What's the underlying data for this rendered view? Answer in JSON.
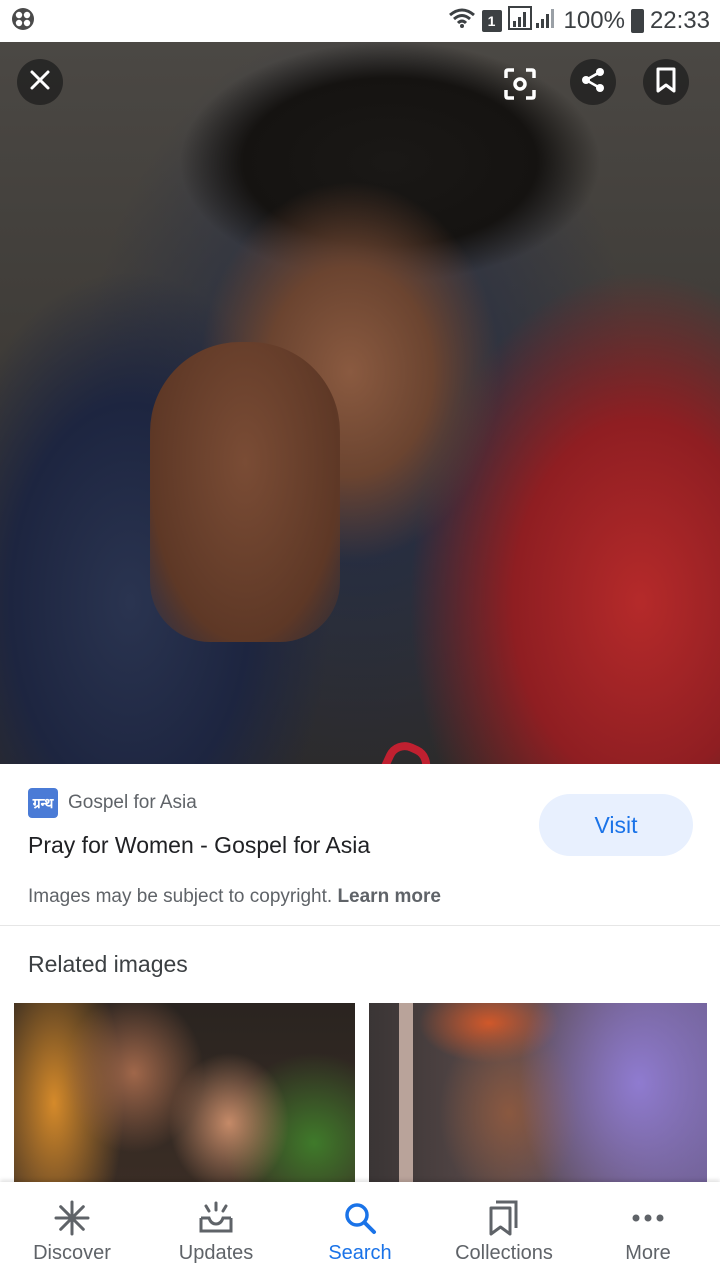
{
  "status_bar": {
    "sim_slot": "1",
    "battery": "100%",
    "time": "22:33"
  },
  "source": {
    "favicon_text": "ग्रन्थ",
    "name": "Gospel for Asia"
  },
  "result": {
    "title": "Pray for Women - Gospel for Asia",
    "visit_label": "Visit"
  },
  "copyright": {
    "text": "Images may be subject to copyright.",
    "learn_more": "Learn more"
  },
  "related": {
    "title": "Related images"
  },
  "nav": {
    "items": [
      {
        "label": "Discover",
        "icon": "asterisk-icon"
      },
      {
        "label": "Updates",
        "icon": "updates-tray-icon"
      },
      {
        "label": "Search",
        "icon": "search-icon"
      },
      {
        "label": "Collections",
        "icon": "collections-icon"
      },
      {
        "label": "More",
        "icon": "more-dots-icon"
      }
    ],
    "active": "Search"
  },
  "colors": {
    "accent": "#1a73e8",
    "visit_bg": "#e8f0fe",
    "text_secondary": "#5f6368"
  }
}
